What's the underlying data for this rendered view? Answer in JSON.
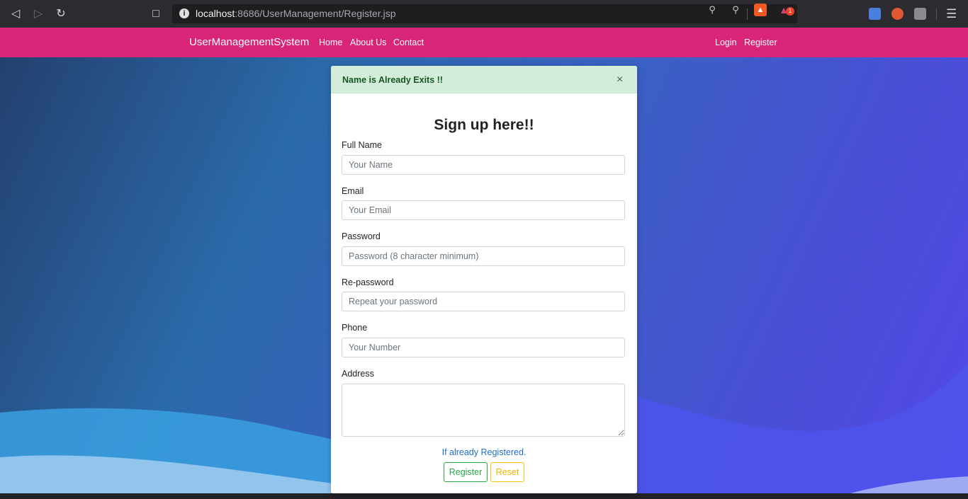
{
  "browser": {
    "url_host": "localhost",
    "url_rest": ":8686/UserManagement/Register.jsp",
    "info_icon": "i",
    "rewards_count": "1"
  },
  "navbar": {
    "brand": "UserManagementSystem",
    "links": [
      "Home",
      "About Us",
      "Contact"
    ],
    "right_links": [
      "Login",
      "Register"
    ],
    "color": "#d92577"
  },
  "alert": {
    "message": "Name is Already Exits !!",
    "close": "×"
  },
  "form": {
    "title": "Sign up here!!",
    "fields": [
      {
        "label": "Full Name",
        "placeholder": "Your Name"
      },
      {
        "label": "Email",
        "placeholder": "Your Email"
      },
      {
        "label": "Password",
        "placeholder": "Password (8 character minimum)"
      },
      {
        "label": "Re-password",
        "placeholder": "Repeat your password"
      },
      {
        "label": "Phone",
        "placeholder": "Your Number"
      },
      {
        "label": "Address",
        "placeholder": ""
      }
    ],
    "login_link": "If already Registered.",
    "register_label": "Register",
    "reset_label": "Reset"
  }
}
